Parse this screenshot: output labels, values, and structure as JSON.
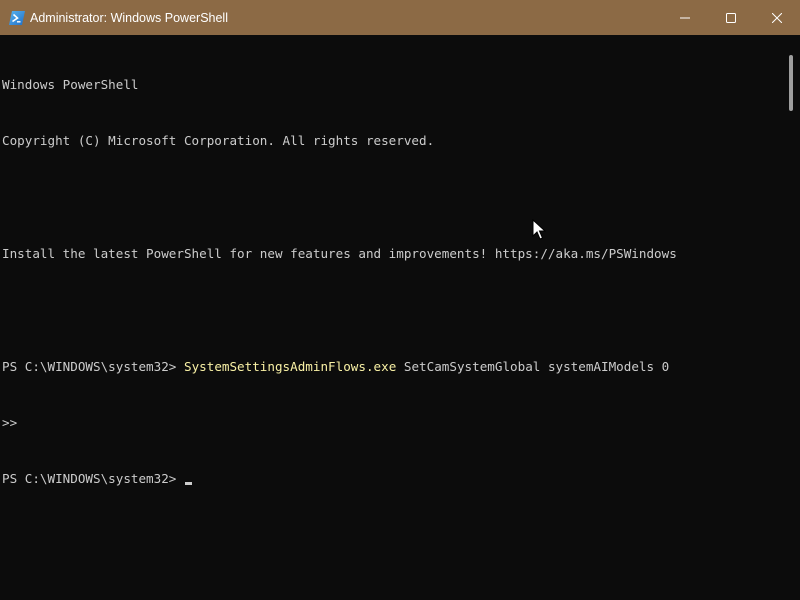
{
  "window": {
    "title": "Administrator: Windows PowerShell",
    "titlebar_color": "#8c6a45",
    "background_color": "#0c0c0c",
    "icon": "powershell-icon"
  },
  "controls": {
    "minimize_icon": "minimize-icon",
    "maximize_icon": "maximize-icon",
    "close_icon": "close-icon"
  },
  "terminal": {
    "text_color": "#cccccc",
    "command_color": "#f9f1a5",
    "lines": [
      {
        "text": "Windows PowerShell"
      },
      {
        "text": "Copyright (C) Microsoft Corporation. All rights reserved."
      },
      {
        "text": ""
      },
      {
        "text": "Install the latest PowerShell for new features and improvements! https://aka.ms/PSWindows"
      },
      {
        "text": ""
      }
    ],
    "prompt1": "PS C:\\WINDOWS\\system32> ",
    "command": "SystemSettingsAdminFlows.exe",
    "args": " SetCamSystemGlobal systemAIModels 0",
    "continuation": ">>",
    "prompt2": "PS C:\\WINDOWS\\system32> "
  }
}
